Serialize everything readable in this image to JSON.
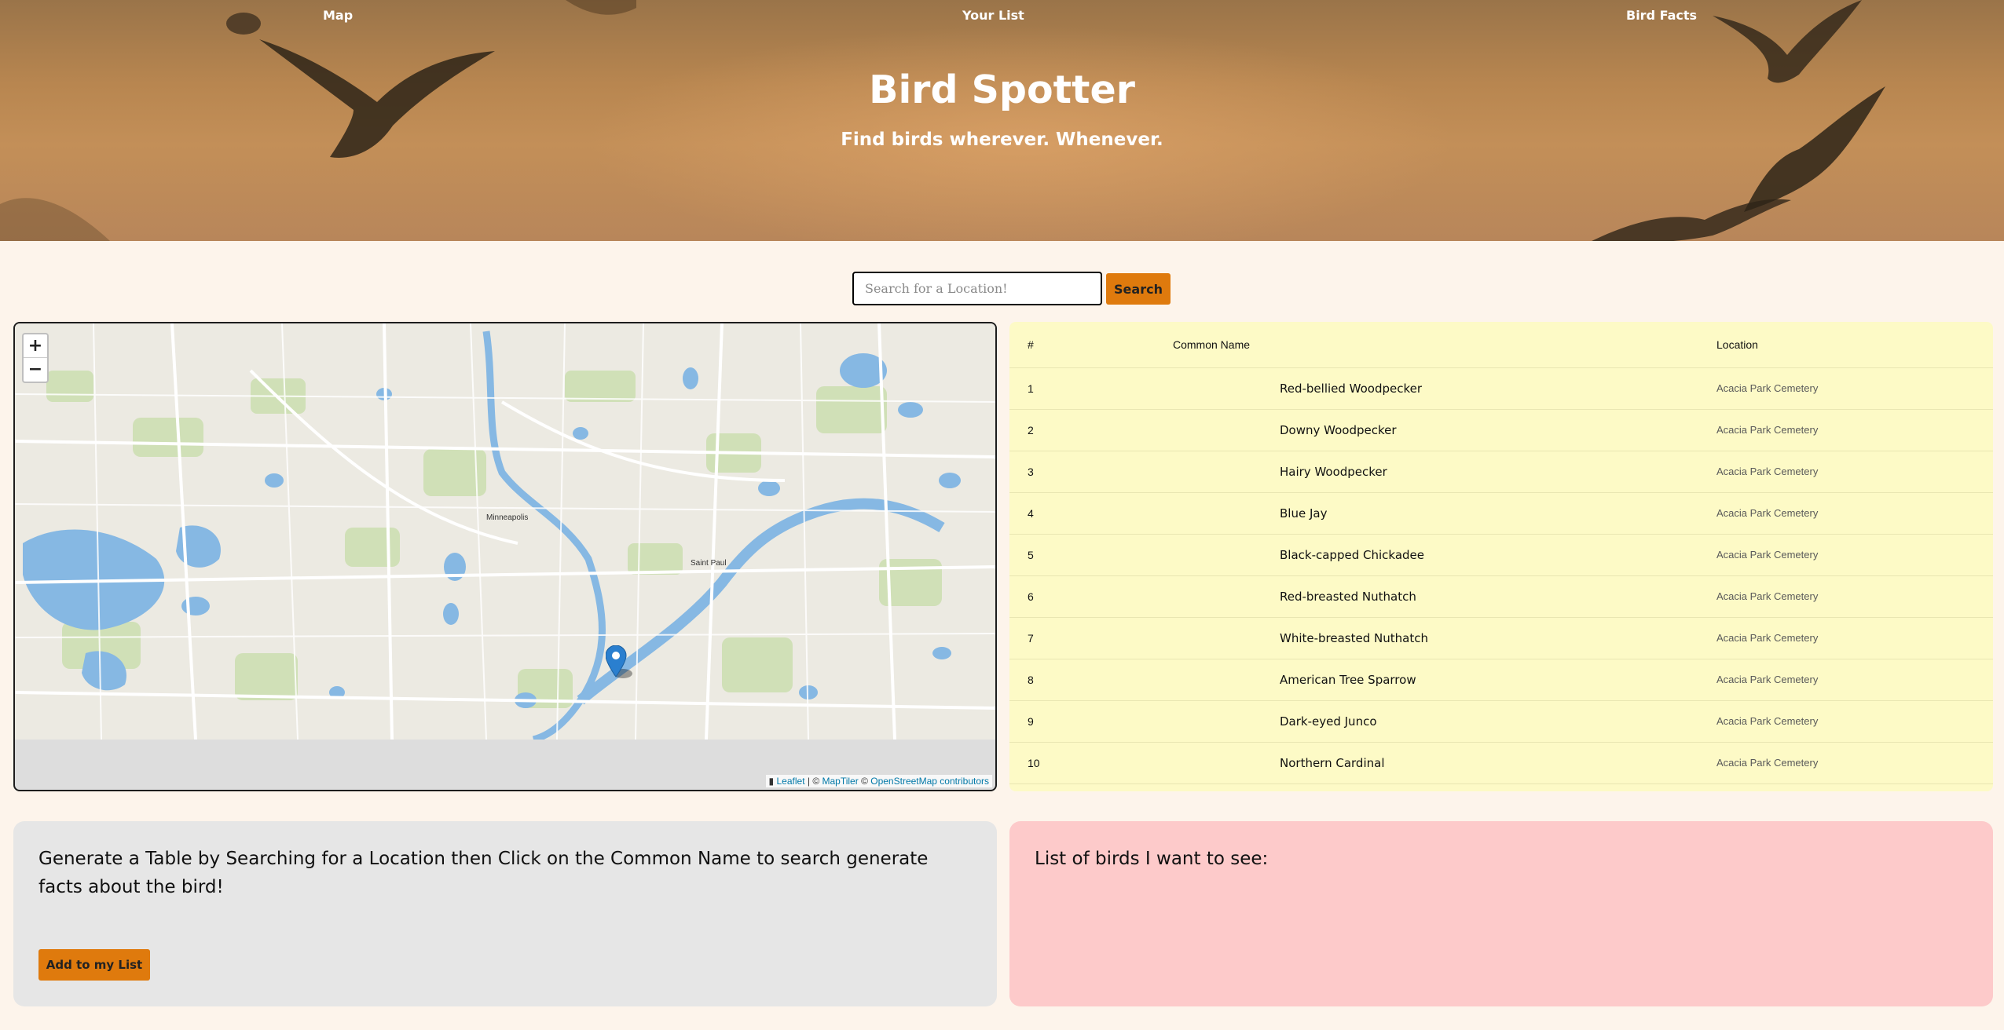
{
  "nav": {
    "items": [
      {
        "label": "Map"
      },
      {
        "label": "Your List"
      },
      {
        "label": "Bird Facts"
      }
    ]
  },
  "hero": {
    "title": "Bird Spotter",
    "subtitle": "Find birds wherever. Whenever."
  },
  "search": {
    "placeholder": "Search for a Location!",
    "value": "",
    "button_label": "Search"
  },
  "map": {
    "zoom_in_label": "+",
    "zoom_out_label": "−",
    "attribution": {
      "leaflet": "Leaflet",
      "separator": " | © ",
      "maptiler": "MapTiler",
      "osm_prefix": " © ",
      "osm": "OpenStreetMap contributors"
    },
    "place_labels": {
      "minneapolis": "Minneapolis",
      "saint_paul": "Saint Paul"
    },
    "colors": {
      "water": "#86b8e3",
      "park": "#c9dcae",
      "road": "#ffffff",
      "marker": "#2a7fcf"
    }
  },
  "table": {
    "headers": {
      "num": "#",
      "name": "Common Name",
      "location": "Location"
    },
    "rows": [
      {
        "num": "1",
        "name": "Red-bellied Woodpecker",
        "location": "Acacia Park Cemetery"
      },
      {
        "num": "2",
        "name": "Downy Woodpecker",
        "location": "Acacia Park Cemetery"
      },
      {
        "num": "3",
        "name": "Hairy Woodpecker",
        "location": "Acacia Park Cemetery"
      },
      {
        "num": "4",
        "name": "Blue Jay",
        "location": "Acacia Park Cemetery"
      },
      {
        "num": "5",
        "name": "Black-capped Chickadee",
        "location": "Acacia Park Cemetery"
      },
      {
        "num": "6",
        "name": "Red-breasted Nuthatch",
        "location": "Acacia Park Cemetery"
      },
      {
        "num": "7",
        "name": "White-breasted Nuthatch",
        "location": "Acacia Park Cemetery"
      },
      {
        "num": "8",
        "name": "American Tree Sparrow",
        "location": "Acacia Park Cemetery"
      },
      {
        "num": "9",
        "name": "Dark-eyed Junco",
        "location": "Acacia Park Cemetery"
      },
      {
        "num": "10",
        "name": "Northern Cardinal",
        "location": "Acacia Park Cemetery"
      }
    ]
  },
  "info": {
    "text": "Generate a Table by Searching for a Location then Click on the Common Name to search generate facts about the bird!",
    "add_button_label": "Add to my List"
  },
  "list": {
    "title": "List of birds I want to see:"
  },
  "colors": {
    "accent": "#df7a0d",
    "background": "#fdf4eb",
    "table_bg": "#fdfac6",
    "list_bg": "#fdcaca",
    "info_bg": "#e6e6e6"
  }
}
